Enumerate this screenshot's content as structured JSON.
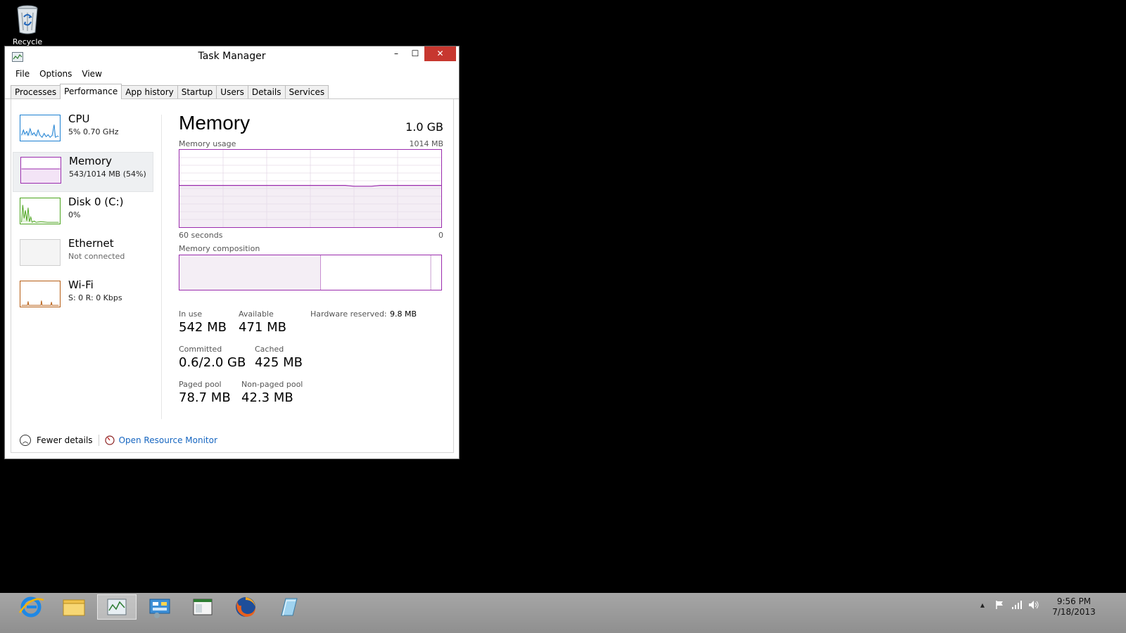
{
  "desktop": {
    "recycle_bin_label": "Recycle Bin"
  },
  "window": {
    "title": "Task Manager",
    "minimize": "–",
    "maximize": "☐",
    "close": "✕",
    "menu": [
      "File",
      "Options",
      "View"
    ],
    "tabs": [
      "Processes",
      "Performance",
      "App history",
      "Startup",
      "Users",
      "Details",
      "Services"
    ],
    "active_tab": "Performance"
  },
  "sidebar": [
    {
      "name": "CPU",
      "sub": "5%  0.70 GHz",
      "color": "#1b7fd1"
    },
    {
      "name": "Memory",
      "sub": "543/1014 MB (54%)",
      "color": "#9b2cae"
    },
    {
      "name": "Disk 0 (C:)",
      "sub": "0%",
      "color": "#4aa31c"
    },
    {
      "name": "Ethernet",
      "sub": "Not connected",
      "color": "#a0a0a0"
    },
    {
      "name": "Wi-Fi",
      "sub": "S: 0  R: 0 Kbps",
      "color": "#b65d13"
    }
  ],
  "memory": {
    "title": "Memory",
    "total": "1.0 GB",
    "usage_label": "Memory usage",
    "usage_max": "1014 MB",
    "time_left": "60 seconds",
    "time_right": "0",
    "composition_label": "Memory composition",
    "usage_level_fraction": 0.54,
    "composition_fractions": {
      "in_use": 0.54,
      "modified": 0.0,
      "standby": 0.42,
      "free": 0.04
    },
    "stats": {
      "in_use_label": "In use",
      "in_use": "542 MB",
      "available_label": "Available",
      "available": "471 MB",
      "hw_reserved_label": "Hardware reserved:",
      "hw_reserved": "9.8 MB",
      "committed_label": "Committed",
      "committed": "0.6/2.0 GB",
      "cached_label": "Cached",
      "cached": "425 MB",
      "paged_label": "Paged pool",
      "paged": "78.7 MB",
      "nonpaged_label": "Non-paged pool",
      "nonpaged": "42.3 MB"
    }
  },
  "footer": {
    "fewer_details": "Fewer details",
    "open_resource_monitor": "Open Resource Monitor"
  },
  "taskbar": {
    "apps": [
      "internet-explorer",
      "file-explorer",
      "task-manager",
      "control-panel",
      "app-window",
      "firefox",
      "notepad"
    ],
    "clock_time": "9:56 PM",
    "clock_date": "7/18/2013"
  }
}
